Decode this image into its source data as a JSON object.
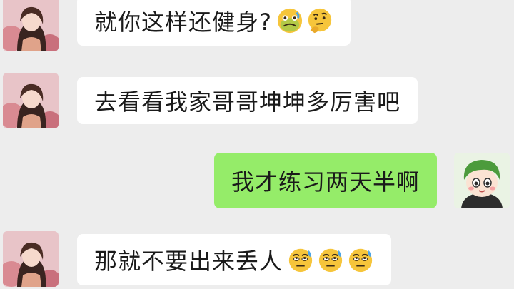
{
  "messages": [
    {
      "direction": "incoming",
      "text": "就你这样还健身?",
      "emoji": [
        "sick-face",
        "thinking-face"
      ]
    },
    {
      "direction": "incoming",
      "text": "去看看我家哥哥坤坤多厉害吧",
      "emoji": []
    },
    {
      "direction": "outgoing",
      "text": "我才练习两天半啊",
      "emoji": []
    },
    {
      "direction": "incoming",
      "text": "那就不要出来丢人",
      "emoji": [
        "rolling-eyes-sweat-face",
        "rolling-eyes-sweat-face",
        "rolling-eyes-sweat-face"
      ]
    }
  ],
  "colors": {
    "background": "#ededed",
    "incoming_bubble": "#ffffff",
    "outgoing_bubble": "#95ec69",
    "text": "#1a1a1a"
  }
}
